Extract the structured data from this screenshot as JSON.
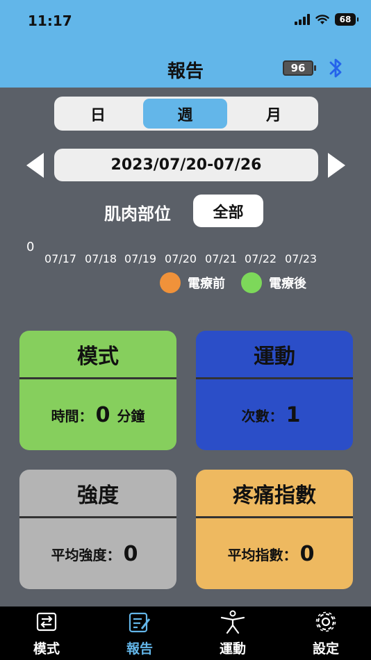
{
  "status_bar": {
    "time": "11:17",
    "battery": "68"
  },
  "header": {
    "title": "報告",
    "device_battery": "96"
  },
  "period_tabs": [
    {
      "label": "日",
      "active": false
    },
    {
      "label": "週",
      "active": true
    },
    {
      "label": "月",
      "active": false
    }
  ],
  "date_range": "2023/07/20-07/26",
  "muscle": {
    "label": "肌肉部位",
    "value": "全部"
  },
  "chart_data": {
    "type": "line",
    "y_ticks": [
      "0"
    ],
    "x": [
      "07/17",
      "07/18",
      "07/19",
      "07/20",
      "07/21",
      "07/22",
      "07/23"
    ],
    "series": [
      {
        "name": "電療前",
        "color": "#f0923a",
        "values": []
      },
      {
        "name": "電療後",
        "color": "#7dd85a",
        "values": []
      }
    ]
  },
  "cards": {
    "mode": {
      "title": "模式",
      "label": "時間：",
      "value": "0",
      "unit": "分鐘",
      "color": "#86cf5d"
    },
    "exercise": {
      "title": "運動",
      "label": "次數：",
      "value": "1",
      "color": "#2b4ec8"
    },
    "intensity": {
      "title": "強度",
      "label": "平均強度：",
      "value": "0",
      "color": "#b4b4b4"
    },
    "pain": {
      "title": "疼痛指數",
      "label": "平均指數：",
      "value": "0",
      "color": "#eeb960"
    }
  },
  "tabbar": [
    {
      "label": "模式",
      "icon": "refresh-icon",
      "active": false
    },
    {
      "label": "報告",
      "icon": "report-icon",
      "active": true
    },
    {
      "label": "運動",
      "icon": "exercise-icon",
      "active": false
    },
    {
      "label": "設定",
      "icon": "gear-icon",
      "active": false
    }
  ]
}
